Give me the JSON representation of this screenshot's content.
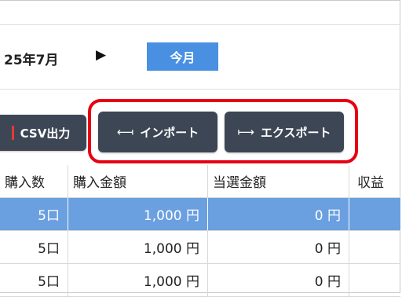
{
  "calendar": {
    "month_label": "25年7月",
    "next_arrow": "▶",
    "today_label": "今月"
  },
  "toolbar": {
    "csv_label": "CSV出力",
    "import_glyph": "⟻",
    "import_label": "インポート",
    "export_glyph": "⟼",
    "export_label": "エクスポート"
  },
  "table": {
    "headers": [
      "購入数",
      "購入金額",
      "当選金額",
      "収益"
    ],
    "rows": [
      {
        "count": "5口",
        "amount": "1,000 円",
        "winnings": "0 円",
        "profit": "",
        "selected": true
      },
      {
        "count": "5口",
        "amount": "1,000 円",
        "winnings": "0 円",
        "profit": "",
        "selected": false
      },
      {
        "count": "5口",
        "amount": "1,000 円",
        "winnings": "0 円",
        "profit": "",
        "selected": false
      }
    ]
  },
  "colors": {
    "accent_blue": "#4a90e2",
    "button_dark": "#3c4655",
    "highlight_red": "#e60012",
    "selected_row": "#6a9fe0"
  }
}
